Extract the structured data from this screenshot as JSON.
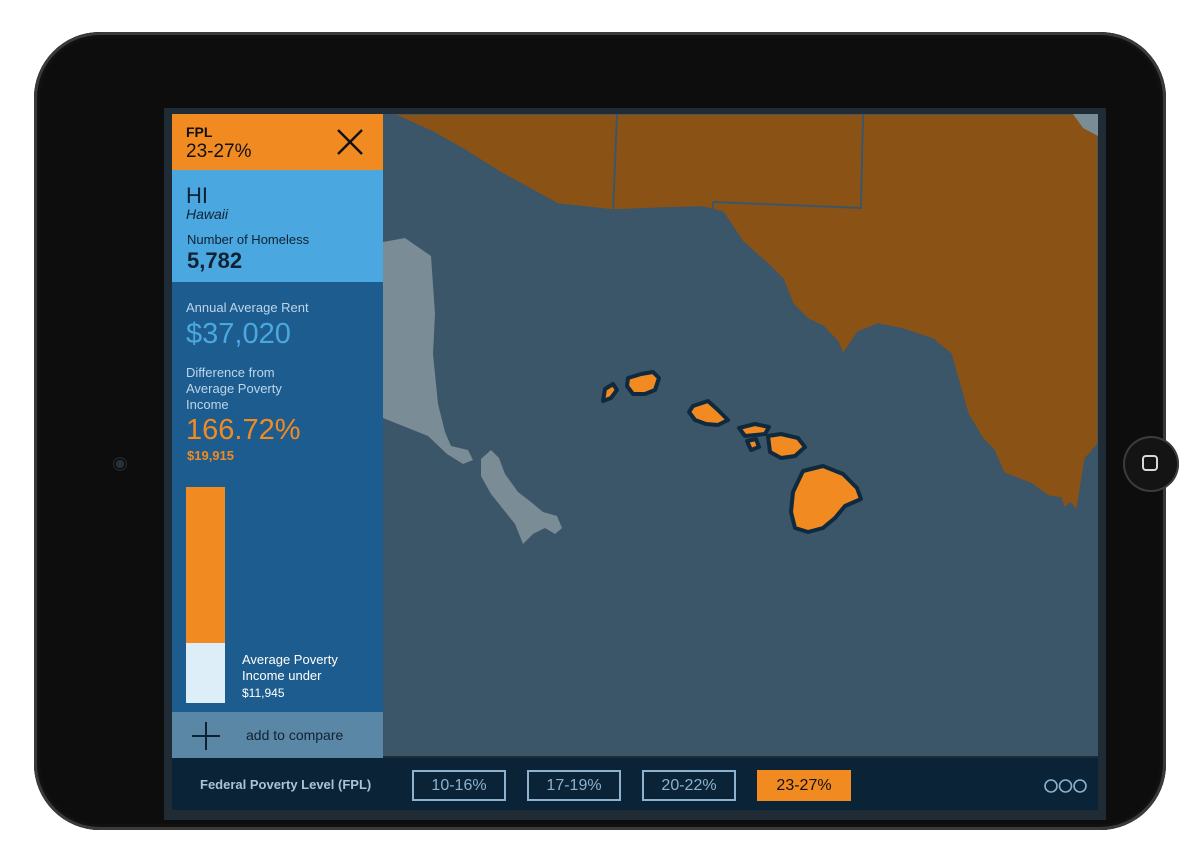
{
  "panel": {
    "fpl_title": "FPL",
    "fpl_range": "23-27%",
    "state_code": "HI",
    "state_name": "Hawaii",
    "homeless_label": "Number of Homeless",
    "homeless_value": "5,782",
    "rent_label": "Annual Average Rent",
    "rent_value": "$37,020",
    "difference_label": "Difference from Average Poverty Income",
    "difference_value": "166.72%",
    "difference_amount": "$19,915",
    "poverty_income_label": "Average Poverty Income under",
    "poverty_income_value": "$11,945",
    "compare_label": "add to compare"
  },
  "bottom_bar": {
    "label": "Federal Poverty Level (FPL)",
    "ranges": [
      "10-16%",
      "17-19%",
      "20-22%",
      "23-27%"
    ],
    "active_range": "23-27%"
  },
  "colors": {
    "accent_orange": "#f28a22",
    "panel_light_blue": "#4aa7df",
    "panel_dark_blue": "#1d5c8e",
    "map_ocean": "#3a5668",
    "map_mainland": "#8b5216",
    "map_alaska": "#7a8c96",
    "island_fill": "#f28a22",
    "island_outline": "#0f2a3e"
  },
  "icons": {
    "close": "close-icon",
    "add": "plus-icon",
    "more": "more-options-icon",
    "home": "home-button-icon"
  }
}
